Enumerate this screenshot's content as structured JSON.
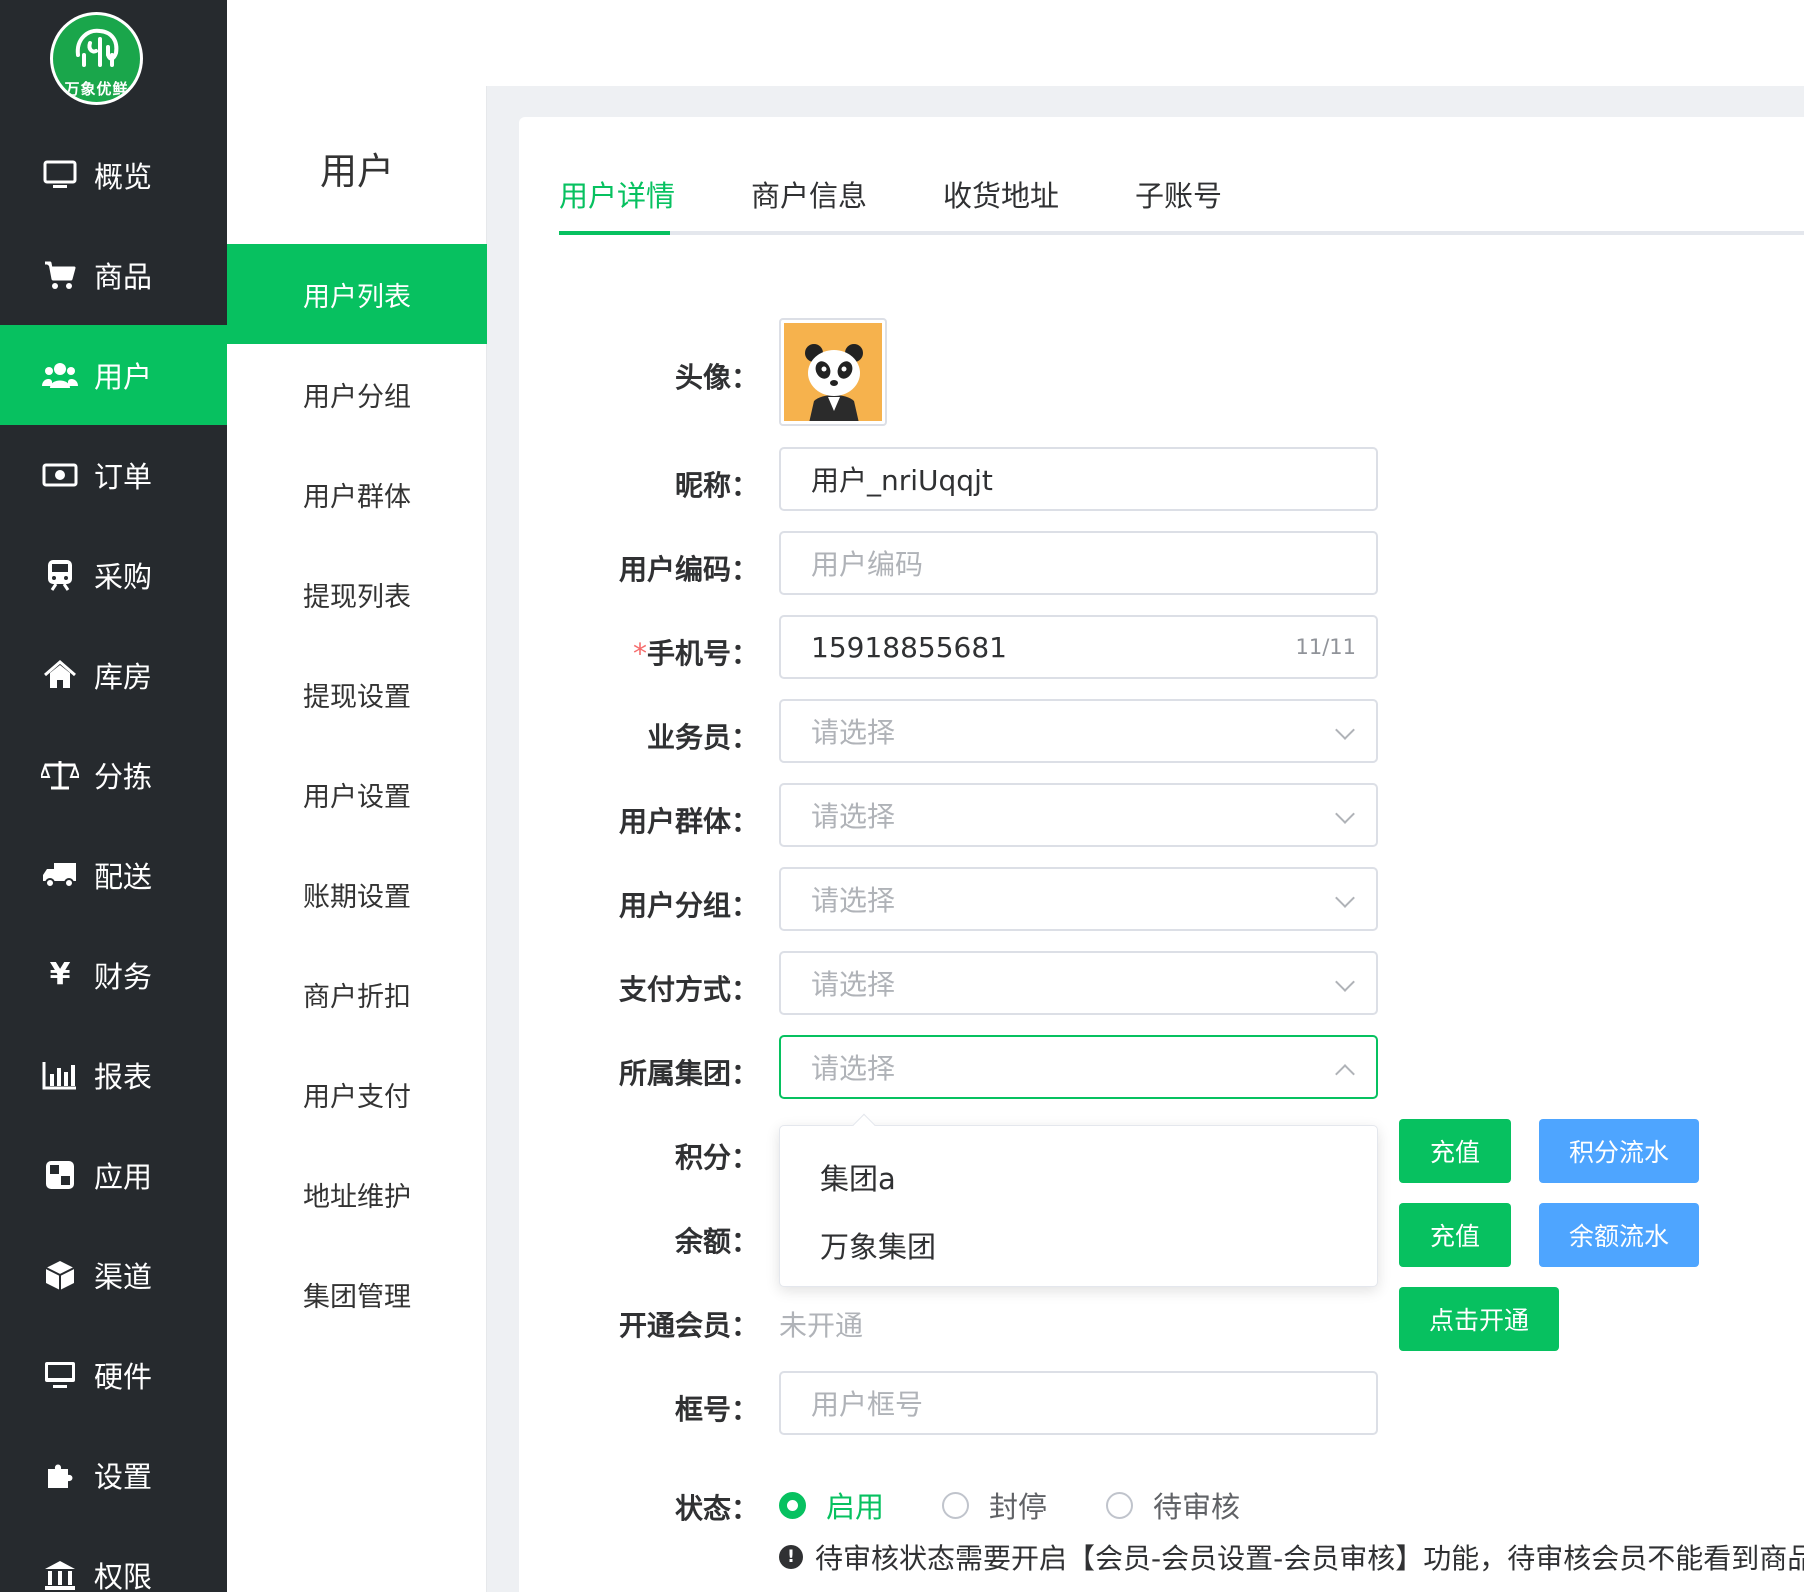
{
  "brand": {
    "logo_text": "万象优鲜",
    "accent": "#07c160",
    "nav_bg": "#262a2e"
  },
  "nav": {
    "items": [
      {
        "label": "概览",
        "icon": "monitor-icon"
      },
      {
        "label": "商品",
        "icon": "cart-icon"
      },
      {
        "label": "用户",
        "icon": "users-icon",
        "active": true
      },
      {
        "label": "订单",
        "icon": "money-icon"
      },
      {
        "label": "采购",
        "icon": "train-icon"
      },
      {
        "label": "库房",
        "icon": "home-icon"
      },
      {
        "label": "分拣",
        "icon": "scale-icon"
      },
      {
        "label": "配送",
        "icon": "truck-icon"
      },
      {
        "label": "财务",
        "icon": "yen-icon"
      },
      {
        "label": "报表",
        "icon": "bar-chart-icon"
      },
      {
        "label": "应用",
        "icon": "apps-icon"
      },
      {
        "label": "渠道",
        "icon": "cube-icon"
      },
      {
        "label": "硬件",
        "icon": "desktop-icon"
      },
      {
        "label": "设置",
        "icon": "puzzle-icon"
      },
      {
        "label": "权限",
        "icon": "bank-icon"
      }
    ]
  },
  "submenu": {
    "title": "用户",
    "items": [
      "用户列表",
      "用户分组",
      "用户群体",
      "提现列表",
      "提现设置",
      "用户设置",
      "账期设置",
      "商户折扣",
      "用户支付",
      "地址维护",
      "集团管理"
    ]
  },
  "tabs": [
    "用户详情",
    "商户信息",
    "收货地址",
    "子账号"
  ],
  "form": {
    "avatar_label": "头像：",
    "nickname_label": "昵称：",
    "nickname_value": "用户_nriUqqjt",
    "code_label": "用户编码：",
    "code_placeholder": "用户编码",
    "phone_required": "*",
    "phone_label": "手机号：",
    "phone_value": "15918855681",
    "phone_count": "11/11",
    "salesman_label": "业务员：",
    "group_label": "用户群体：",
    "category_label": "用户分组：",
    "pay_label": "支付方式：",
    "org_label": "所属集团：",
    "select_placeholder": "请选择",
    "points_label": "积分：",
    "balance_label": "余额：",
    "member_label": "开通会员：",
    "member_value": "未开通",
    "box_label": "框号：",
    "box_placeholder": "用户框号",
    "status_label": "状态："
  },
  "dropdown_options": [
    "集团a",
    "万象集团"
  ],
  "buttons": {
    "recharge": "充值",
    "points_flow": "积分流水",
    "balance_flow": "余额流水",
    "open_member": "点击开通"
  },
  "status_options": [
    {
      "label": "启用",
      "checked": true
    },
    {
      "label": "封停",
      "checked": false
    },
    {
      "label": "待审核",
      "checked": false
    }
  ],
  "tip": "待审核状态需要开启【会员-会员设置-会员审核】功能，待审核会员不能看到商品"
}
